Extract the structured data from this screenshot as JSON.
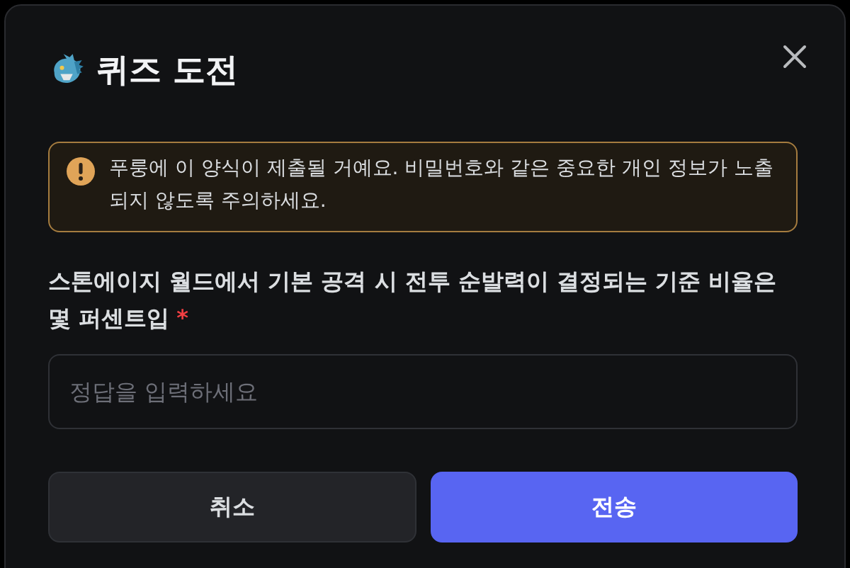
{
  "dialog": {
    "title": "퀴즈 도전"
  },
  "notice": {
    "text": "푸룽에 이 양식이 제출될 거예요. 비밀번호와 같은 중요한 개인 정보가 노출되지 않도록 주의하세요."
  },
  "question": {
    "label": "스톤에이지 월드에서 기본 공격 시 전투 순발력이 결정되는 기준 비율은 몇 퍼센트입",
    "required_mark": "*"
  },
  "answer": {
    "placeholder": "정답을 입력하세요"
  },
  "buttons": [
    {
      "label": "취소",
      "kind": "secondary"
    },
    {
      "label": "전송",
      "kind": "primary"
    }
  ]
}
